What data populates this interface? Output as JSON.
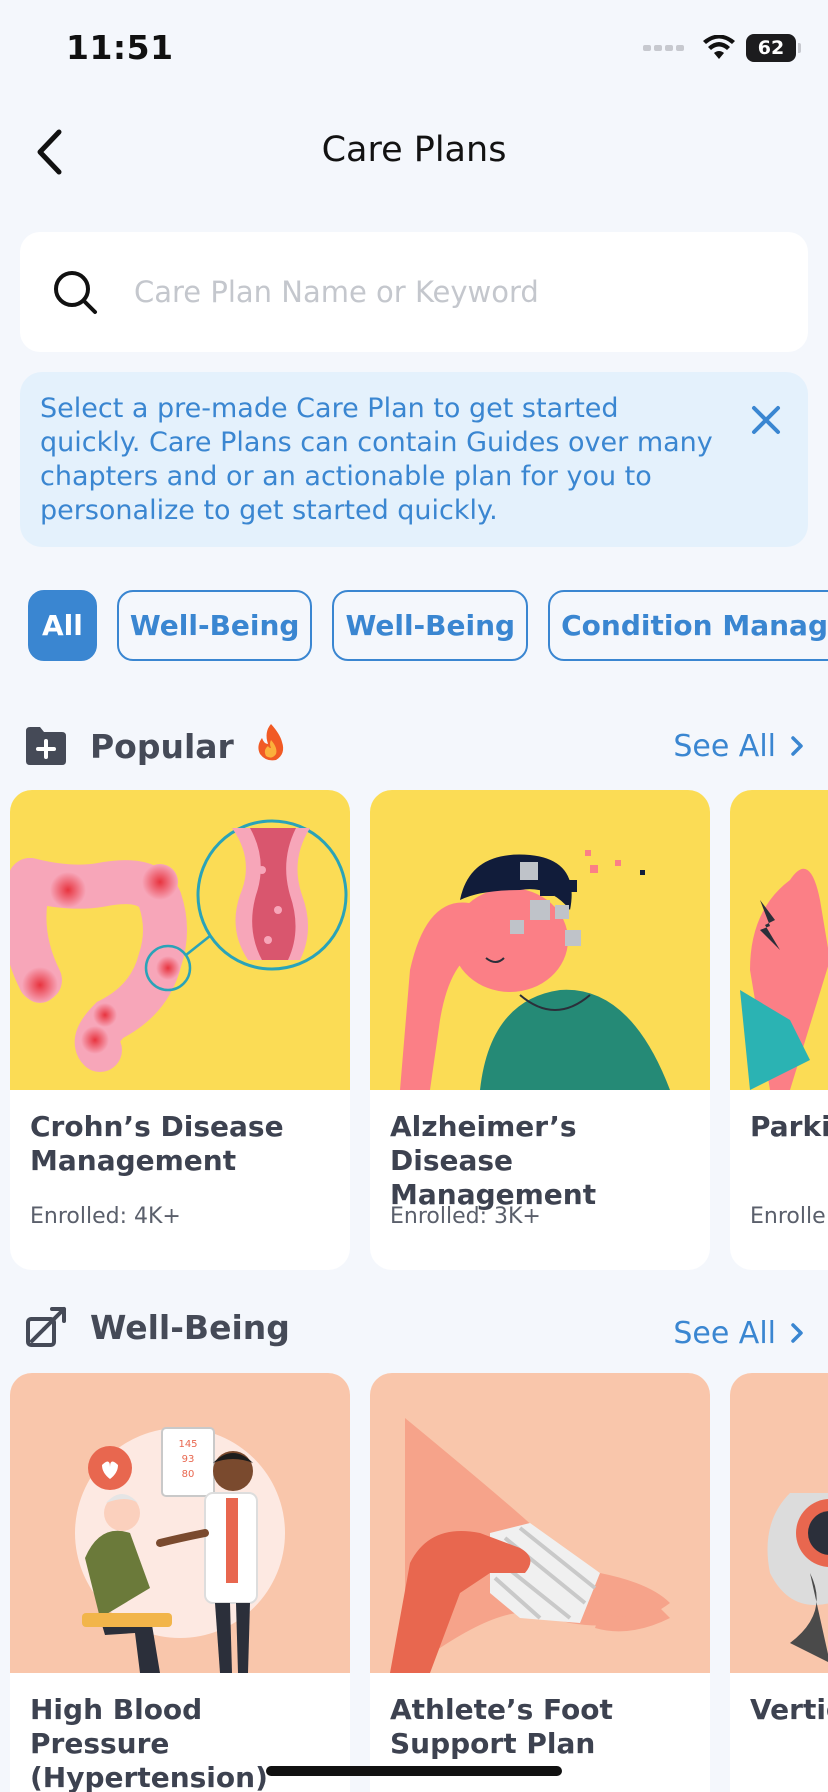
{
  "status_bar": {
    "time": "11:51",
    "battery": "62"
  },
  "header": {
    "title": "Care Plans"
  },
  "search": {
    "placeholder": "Care Plan Name or Keyword"
  },
  "banner": {
    "text": "Select a pre-made Care Plan to get started quickly. Care Plans can contain Guides over many chapters and or an actionable plan for you to personalize to get started quickly."
  },
  "filters": [
    {
      "label": "All",
      "active": true
    },
    {
      "label": "Well-Being",
      "active": false
    },
    {
      "label": "Well-Being",
      "active": false
    },
    {
      "label": "Condition Manage",
      "active": false
    }
  ],
  "popular": {
    "title": "Popular",
    "see_all": "See All",
    "cards": [
      {
        "title": "Crohn’s Disease Management",
        "enrolled": "Enrolled: 4K+"
      },
      {
        "title": "Alzheimer’s Disease Management",
        "enrolled": "Enrolled: 3K+"
      },
      {
        "title": "Parkin Plan",
        "enrolled": "Enrolle"
      }
    ]
  },
  "wellbeing": {
    "title": "Well-Being",
    "see_all": "See All",
    "cards": [
      {
        "title": "High Blood Pressure (Hypertension)"
      },
      {
        "title": "Athlete’s Foot Support Plan"
      },
      {
        "title": "Vertig Mana"
      }
    ],
    "bp_monitor": [
      "145",
      "93",
      "80"
    ]
  },
  "colors": {
    "accent": "#3a86d1",
    "background": "#f4f7fc",
    "card_yellow": "#fbdc55",
    "card_peach": "#f9c6ab"
  }
}
